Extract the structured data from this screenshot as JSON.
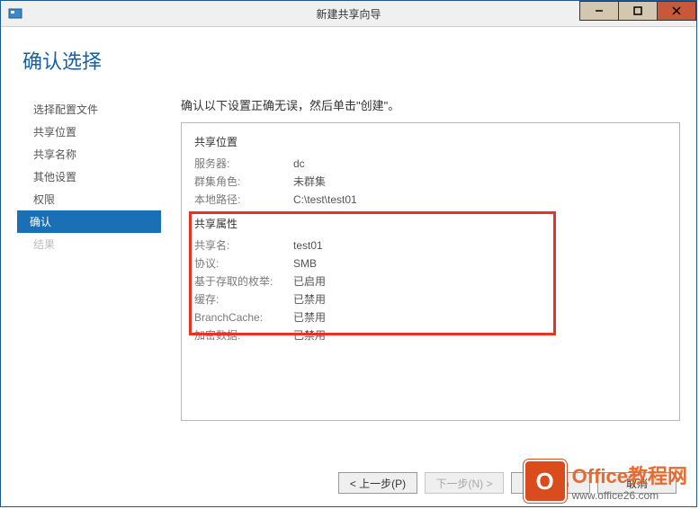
{
  "window": {
    "title": "新建共享向导"
  },
  "page": {
    "heading": "确认选择",
    "instruction": "确认以下设置正确无误，然后单击\"创建\"。"
  },
  "sidebar": {
    "items": [
      {
        "label": "选择配置文件"
      },
      {
        "label": "共享位置"
      },
      {
        "label": "共享名称"
      },
      {
        "label": "其他设置"
      },
      {
        "label": "权限"
      },
      {
        "label": "确认"
      },
      {
        "label": "结果"
      }
    ]
  },
  "sections": {
    "location": {
      "title": "共享位置",
      "rows": [
        {
          "label": "服务器:",
          "value": "dc"
        },
        {
          "label": "群集角色:",
          "value": "未群集"
        },
        {
          "label": "本地路径:",
          "value": "C:\\test\\test01"
        }
      ]
    },
    "properties": {
      "title": "共享属性",
      "rows": [
        {
          "label": "共享名:",
          "value": "test01"
        },
        {
          "label": "协议:",
          "value": "SMB"
        },
        {
          "label": "基于存取的枚举:",
          "value": "已启用"
        },
        {
          "label": "缓存:",
          "value": "已禁用"
        },
        {
          "label": "BranchCache:",
          "value": "已禁用"
        },
        {
          "label": "加密数据:",
          "value": "已禁用"
        }
      ]
    }
  },
  "footer": {
    "prev": "< 上一步(P)",
    "next": "下一步(N) >",
    "create": "创建(C)",
    "cancel": "取消"
  },
  "watermark": {
    "brand": "Office教程网",
    "url": "www.office26.com",
    "logo_letter": "O"
  }
}
